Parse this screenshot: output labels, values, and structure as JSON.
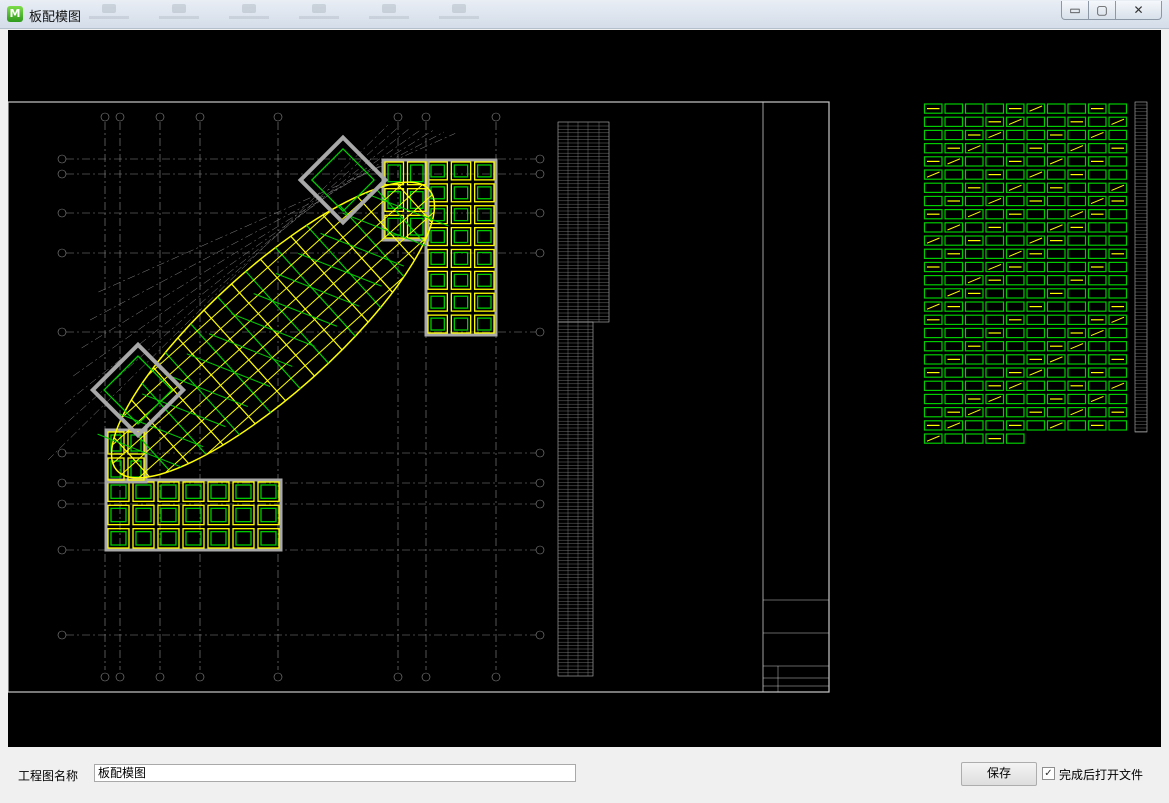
{
  "window": {
    "app_icon_letter": "M",
    "title": "板配模图",
    "controls": {
      "minimize": "▭",
      "maximize": "▢",
      "close": "✕"
    }
  },
  "drawing": {
    "background": "#000000",
    "colors": {
      "frame": "#c8c8c8",
      "grid": "#8a8a8a",
      "wall": "#a8a8a8",
      "panel_yellow": "#ffff00",
      "panel_green": "#00cc00"
    }
  },
  "footer": {
    "name_label": "工程图名称",
    "name_value": "板配模图",
    "save_label": "保存",
    "open_after_label": "完成后打开文件",
    "open_after_checked": true
  }
}
